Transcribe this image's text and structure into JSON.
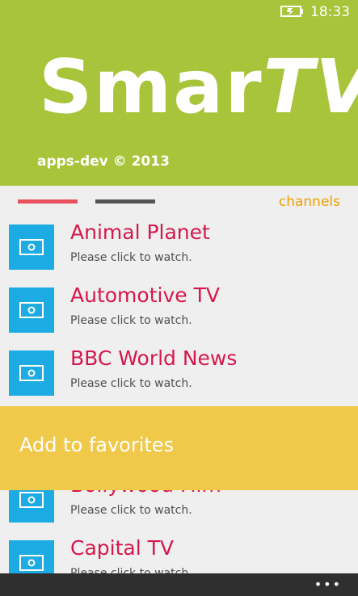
{
  "status": {
    "time": "18:33",
    "battery_icon": "battery-charging-icon"
  },
  "header": {
    "title_main": "Smar",
    "title_tv": "TV",
    "copyright": "apps-dev © 2013",
    "background": "#a8c43a"
  },
  "pivot": {
    "label": "channels",
    "active_color": "#e8505e",
    "inactive_color": "#555555"
  },
  "channels": [
    {
      "name": "Animal Planet",
      "subtitle": "Please click to watch."
    },
    {
      "name": "Automotive TV",
      "subtitle": "Please click to watch."
    },
    {
      "name": "BBC World News",
      "subtitle": "Please click to watch."
    },
    {
      "name": "Bollywood Film",
      "subtitle": "Please click to watch."
    },
    {
      "name": "Capital TV",
      "subtitle": "Please click to watch."
    }
  ],
  "context_menu": {
    "label": "Add to favorites",
    "background": "#f0c84a"
  },
  "app_bar": {
    "more_label": "•••"
  },
  "colors": {
    "tile": "#1cabe3",
    "channel_name": "#d6174d",
    "accent": "#f0a000"
  }
}
